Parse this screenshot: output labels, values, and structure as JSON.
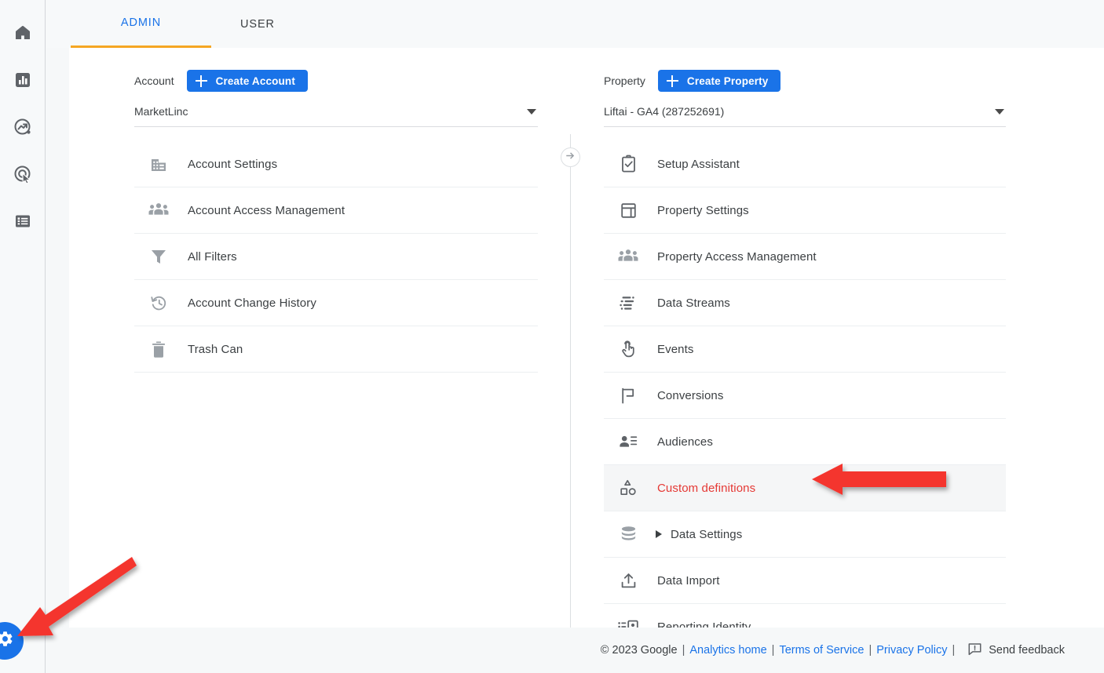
{
  "app": {
    "accent_blue": "#1a73e8",
    "tab_underline": "#f5a623",
    "highlight_red": "#e53935",
    "annotation_red": "#f4352f"
  },
  "rail": {
    "items": [
      {
        "name": "home-icon",
        "label": "Home"
      },
      {
        "name": "reports-icon",
        "label": "Reports"
      },
      {
        "name": "explore-icon",
        "label": "Explore"
      },
      {
        "name": "advertising-icon",
        "label": "Advertising"
      },
      {
        "name": "library-icon",
        "label": "Library"
      }
    ],
    "admin_fab": {
      "name": "gear-icon",
      "label": "Admin"
    }
  },
  "tabs": [
    {
      "label": "ADMIN",
      "active": true
    },
    {
      "label": "USER",
      "active": false
    }
  ],
  "account": {
    "header_label": "Account",
    "create_button": "Create Account",
    "selected": "MarketLinc",
    "items": [
      {
        "label": "Account Settings",
        "icon": "building-icon"
      },
      {
        "label": "Account Access Management",
        "icon": "people-icon"
      },
      {
        "label": "All Filters",
        "icon": "funnel-icon"
      },
      {
        "label": "Account Change History",
        "icon": "history-icon"
      },
      {
        "label": "Trash Can",
        "icon": "trash-icon"
      }
    ]
  },
  "property": {
    "header_label": "Property",
    "create_button": "Create Property",
    "selected": "Liftai - GA4 (287252691)",
    "items": [
      {
        "label": "Setup Assistant",
        "icon": "clipboard-check-icon",
        "highlighted": false,
        "expandable": false
      },
      {
        "label": "Property Settings",
        "icon": "layout-icon",
        "highlighted": false,
        "expandable": false
      },
      {
        "label": "Property Access Management",
        "icon": "people-icon",
        "highlighted": false,
        "expandable": false
      },
      {
        "label": "Data Streams",
        "icon": "data-streams-icon",
        "highlighted": false,
        "expandable": false
      },
      {
        "label": "Events",
        "icon": "tap-icon",
        "highlighted": false,
        "expandable": false
      },
      {
        "label": "Conversions",
        "icon": "flag-icon",
        "highlighted": false,
        "expandable": false
      },
      {
        "label": "Audiences",
        "icon": "audience-icon",
        "highlighted": false,
        "expandable": false
      },
      {
        "label": "Custom definitions",
        "icon": "shapes-icon",
        "highlighted": true,
        "expandable": false
      },
      {
        "label": "Data Settings",
        "icon": "database-icon",
        "highlighted": false,
        "expandable": true
      },
      {
        "label": "Data Import",
        "icon": "upload-icon",
        "highlighted": false,
        "expandable": false
      },
      {
        "label": "Reporting Identity",
        "icon": "identity-icon",
        "highlighted": false,
        "expandable": false
      }
    ]
  },
  "divider": {
    "button_icon": "arrow-right-circle-icon"
  },
  "footer": {
    "copyright": "© 2023 Google",
    "links": [
      {
        "label": "Analytics home"
      },
      {
        "label": "Terms of Service"
      },
      {
        "label": "Privacy Policy"
      }
    ],
    "separator": "|",
    "feedback_label": "Send feedback",
    "feedback_icon": "feedback-icon"
  },
  "annotations": [
    {
      "name": "arrow-to-custom-definitions",
      "color": "#f4352f",
      "points_to": "Custom definitions"
    },
    {
      "name": "arrow-to-admin-gear",
      "color": "#f4352f",
      "points_to": "Admin gear button"
    }
  ]
}
